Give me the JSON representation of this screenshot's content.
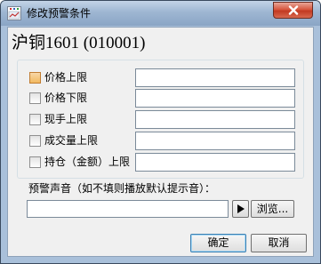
{
  "window": {
    "title": "修改预警条件",
    "close_icon": "close-icon"
  },
  "heading": "沪铜1601 (010001)",
  "conditions": [
    {
      "label": "价格上限",
      "checked": false,
      "value": ""
    },
    {
      "label": "价格下限",
      "checked": false,
      "value": ""
    },
    {
      "label": "现手上限",
      "checked": false,
      "value": ""
    },
    {
      "label": "成交量上限",
      "checked": false,
      "value": ""
    },
    {
      "label": "持仓（金额）上限",
      "checked": false,
      "value": ""
    }
  ],
  "sound": {
    "label": "预警声音（如不填则播放默认提示音）：",
    "value": "",
    "play_icon": "play-icon",
    "browse_label": "浏览..."
  },
  "buttons": {
    "ok_label": "确定",
    "cancel_label": "取消"
  }
}
